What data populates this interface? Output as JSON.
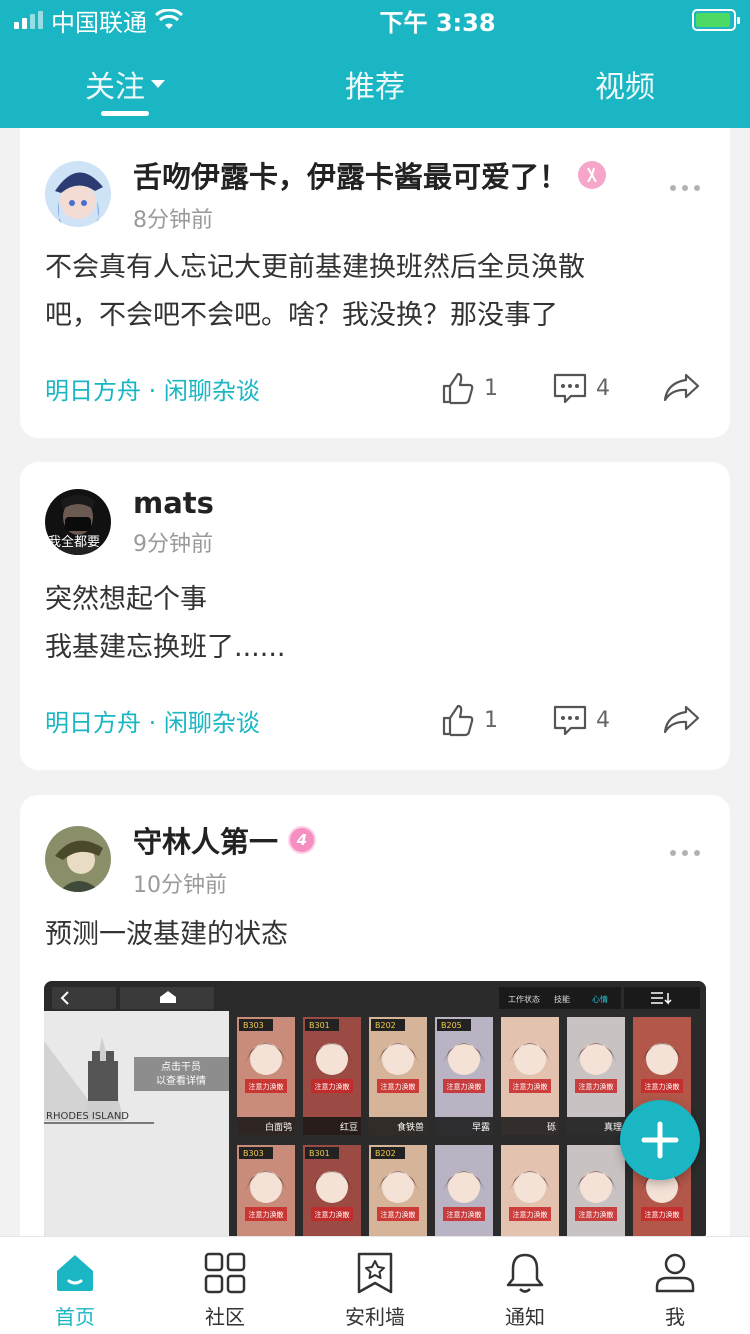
{
  "status": {
    "carrier": "中国联通",
    "time": "下午 3:38"
  },
  "tabs": [
    {
      "label": "关注",
      "active": true
    },
    {
      "label": "推荐",
      "active": false
    },
    {
      "label": "视频",
      "active": false
    }
  ],
  "posts": [
    {
      "username": "舌吻伊露卡，伊露卡酱最可爱了！",
      "time": "8分钟前",
      "content": "不会真有人忘记大更前基建换班然后全员涣散\n吧，不会吧不会吧。啥？我没换？那没事了",
      "topic": "明日方舟 · 闲聊杂谈",
      "likes": "1",
      "comments": "4"
    },
    {
      "username": "mats",
      "time": "9分钟前",
      "avatar_text": "我全都要",
      "content": "突然想起个事\n我基建忘换班了......",
      "topic": "明日方舟 · 闲聊杂谈",
      "likes": "1",
      "comments": "4"
    },
    {
      "username": "守林人第一",
      "level": "4",
      "time": "10分钟前",
      "content": "预测一波基建的状态",
      "image": {
        "detail_hint": "点击干员\n以查看详情",
        "logo_text": "RHODES ISLAND",
        "header_tabs": [
          "工作状态",
          "技能",
          "心情"
        ],
        "operators": [
          {
            "room": "B303",
            "name": "白面鸮"
          },
          {
            "room": "B301",
            "name": "红豆"
          },
          {
            "room": "B202",
            "name": "食铁兽"
          },
          {
            "room": "B205",
            "name": "早露"
          },
          {
            "room": "",
            "name": "砾"
          },
          {
            "room": "",
            "name": "真理"
          },
          {
            "room": "",
            "name": ""
          },
          {
            "room": "B303",
            "name": ""
          },
          {
            "room": "B301",
            "name": ""
          },
          {
            "room": "B202",
            "name": ""
          },
          {
            "room": "",
            "name": ""
          },
          {
            "room": "",
            "name": ""
          },
          {
            "room": "",
            "name": ""
          },
          {
            "room": "",
            "name": ""
          }
        ],
        "status_text": "注意力涣散"
      }
    }
  ],
  "nav": [
    {
      "label": "首页",
      "icon": "home-icon",
      "active": true
    },
    {
      "label": "社区",
      "icon": "grid-icon",
      "active": false
    },
    {
      "label": "安利墙",
      "icon": "bookmark-star-icon",
      "active": false
    },
    {
      "label": "通知",
      "icon": "bell-icon",
      "active": false
    },
    {
      "label": "我",
      "icon": "person-icon",
      "active": false
    }
  ],
  "colors": {
    "accent": "#1ab6c3",
    "level_badge": "#f58ec1"
  }
}
